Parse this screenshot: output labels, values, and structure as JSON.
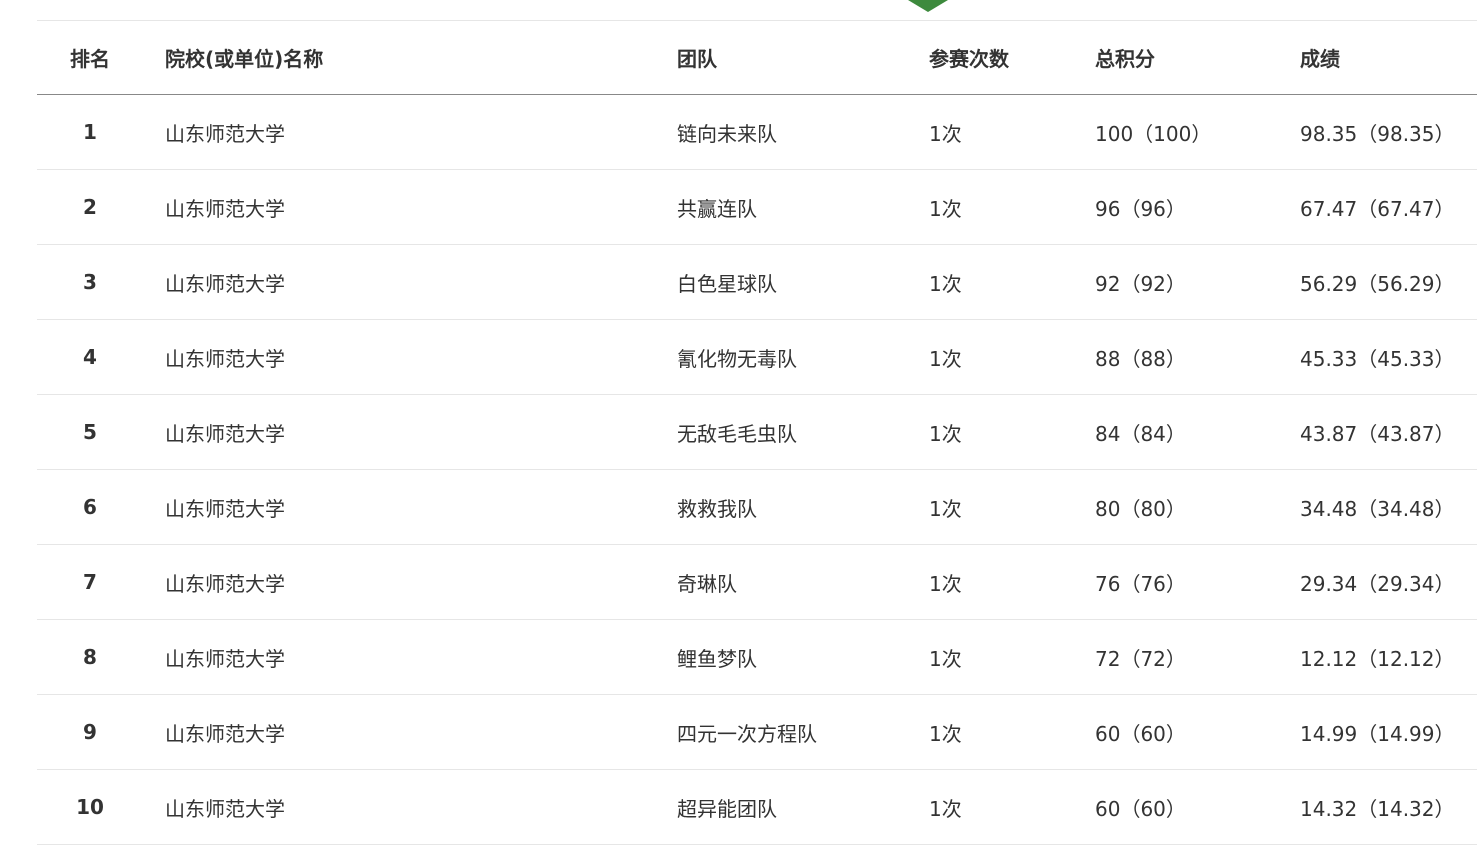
{
  "accent_color": "#3d8a3d",
  "table": {
    "headers": {
      "rank": "排名",
      "school": "院校(或单位)名称",
      "team": "团队",
      "count": "参赛次数",
      "score": "总积分",
      "result": "成绩"
    },
    "rows": [
      {
        "rank": "1",
        "school": "山东师范大学",
        "team": "链向未来队",
        "count": "1次",
        "score": "100（100）",
        "result": "98.35（98.35）"
      },
      {
        "rank": "2",
        "school": "山东师范大学",
        "team": "共赢连队",
        "count": "1次",
        "score": "96（96）",
        "result": "67.47（67.47）"
      },
      {
        "rank": "3",
        "school": "山东师范大学",
        "team": "白色星球队",
        "count": "1次",
        "score": "92（92）",
        "result": "56.29（56.29）"
      },
      {
        "rank": "4",
        "school": "山东师范大学",
        "team": "氰化物无毒队",
        "count": "1次",
        "score": "88（88）",
        "result": "45.33（45.33）"
      },
      {
        "rank": "5",
        "school": "山东师范大学",
        "team": "无敌毛毛虫队",
        "count": "1次",
        "score": "84（84）",
        "result": "43.87（43.87）"
      },
      {
        "rank": "6",
        "school": "山东师范大学",
        "team": "救救我队",
        "count": "1次",
        "score": "80（80）",
        "result": "34.48（34.48）"
      },
      {
        "rank": "7",
        "school": "山东师范大学",
        "team": "奇琳队",
        "count": "1次",
        "score": "76（76）",
        "result": "29.34（29.34）"
      },
      {
        "rank": "8",
        "school": "山东师范大学",
        "team": "鲤鱼梦队",
        "count": "1次",
        "score": "72（72）",
        "result": "12.12（12.12）"
      },
      {
        "rank": "9",
        "school": "山东师范大学",
        "team": "四元一次方程队",
        "count": "1次",
        "score": "60（60）",
        "result": "14.99（14.99）"
      },
      {
        "rank": "10",
        "school": "山东师范大学",
        "team": "超异能团队",
        "count": "1次",
        "score": "60（60）",
        "result": "14.32（14.32）"
      }
    ]
  }
}
